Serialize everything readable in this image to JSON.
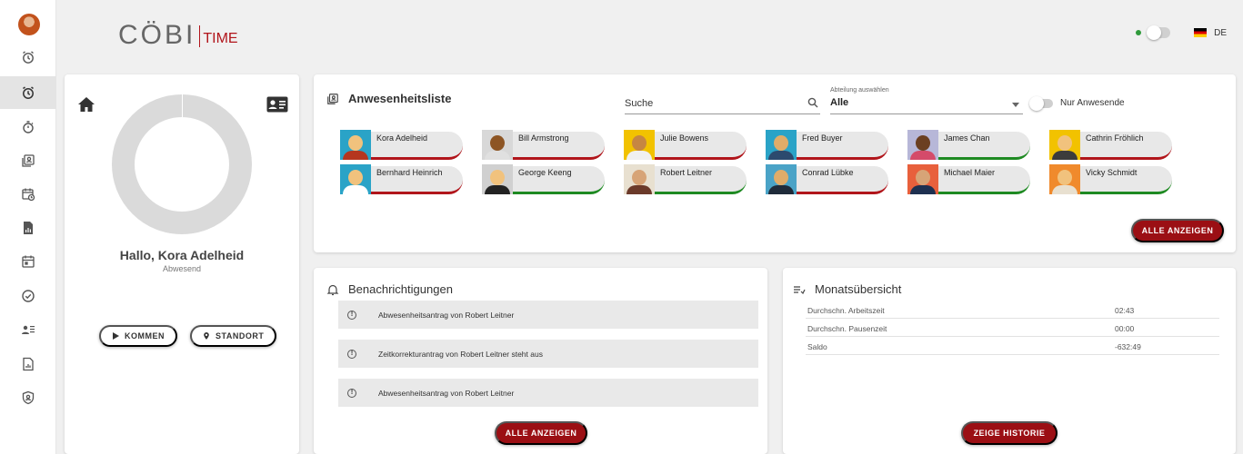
{
  "header": {
    "logo_main": "CÖBI",
    "logo_sub": "TIME",
    "language": "DE",
    "brand_color": "#b1151b"
  },
  "sidebar": {
    "items": [
      {
        "name": "alarm-clock-icon"
      },
      {
        "name": "alarm-clock-icon",
        "active": true
      },
      {
        "name": "timer-icon"
      },
      {
        "name": "presence-list-icon"
      },
      {
        "name": "calendar-schedule-icon"
      },
      {
        "name": "report-file-icon"
      },
      {
        "name": "calendar-icon"
      },
      {
        "name": "check-circle-icon"
      },
      {
        "name": "user-list-icon"
      },
      {
        "name": "document-chart-icon"
      },
      {
        "name": "admin-shield-icon"
      }
    ]
  },
  "profile": {
    "greeting": "Hallo, Kora Adelheid",
    "status": "Abwesend",
    "come_label": "KOMMEN",
    "location_label": "STANDORT"
  },
  "attendance": {
    "title": "Anwesenheitsliste",
    "search_placeholder": "Suche",
    "department_label": "Abteilung auswählen",
    "department_value": "Alle",
    "only_present_label": "Nur Anwesende",
    "show_all_label": "ALLE ANZEIGEN",
    "people": [
      {
        "name": "Kora Adelheid",
        "present": false
      },
      {
        "name": "Bill Armstrong",
        "present": false
      },
      {
        "name": "Julie Bowens",
        "present": false
      },
      {
        "name": "Fred Buyer",
        "present": false
      },
      {
        "name": "James Chan",
        "present": true
      },
      {
        "name": "Cathrin Fröhlich",
        "present": false
      },
      {
        "name": "Bernhard Heinrich",
        "present": false
      },
      {
        "name": "George Keeng",
        "present": true
      },
      {
        "name": "Robert Leitner",
        "present": true
      },
      {
        "name": "Conrad Lübke",
        "present": false
      },
      {
        "name": "Michael Maier",
        "present": true
      },
      {
        "name": "Vicky Schmidt",
        "present": true
      }
    ]
  },
  "notifications": {
    "title": "Benachrichtigungen",
    "items": [
      "Abwesenheitsantrag von Robert Leitner",
      "Zeitkorrekturantrag von Robert Leitner steht aus",
      "Abwesenheitsantrag von Robert Leitner"
    ],
    "show_all_label": "ALLE ANZEIGEN"
  },
  "month_overview": {
    "title": "Monatsübersicht",
    "rows": [
      {
        "label": "Durchschn. Arbeitszeit",
        "value": "02:43"
      },
      {
        "label": "Durchschn. Pausenzeit",
        "value": "00:00"
      },
      {
        "label": "Saldo",
        "value": "-632:49"
      }
    ],
    "history_label": "ZEIGE HISTORIE"
  }
}
